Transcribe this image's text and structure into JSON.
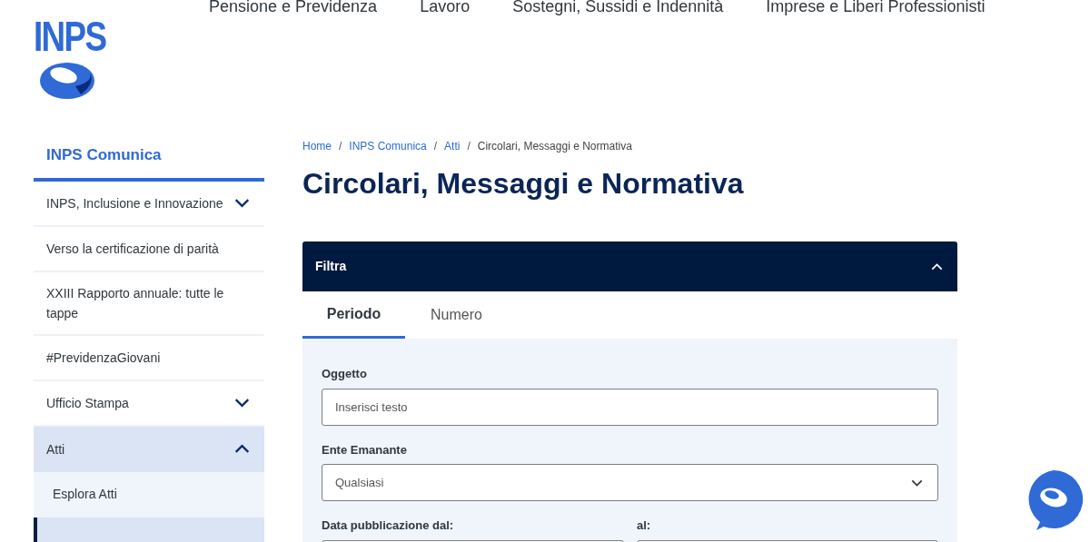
{
  "header": {
    "logo": "INPS",
    "nav": [
      "Pensione e Previdenza",
      "Lavoro",
      "Sostegni, Sussidi e Indennità",
      "Imprese e Liberi Professionisti"
    ]
  },
  "sidebar": {
    "title": "INPS Comunica",
    "items": [
      {
        "label": "INPS, Inclusione e Innovazione",
        "expanded": false
      },
      {
        "label": "Verso la certificazione di parità"
      },
      {
        "label": "XXIII Rapporto annuale: tutte le tappe"
      },
      {
        "label": "#PrevidenzaGiovani"
      },
      {
        "label": "Ufficio Stampa",
        "expanded": false
      },
      {
        "label": "Atti",
        "expanded": true,
        "children": [
          {
            "label": "Esplora Atti",
            "selected": false
          },
          {
            "selected": true
          }
        ]
      }
    ]
  },
  "breadcrumb": [
    {
      "label": "Home",
      "current": false
    },
    {
      "separator": "/",
      "label": "INPS Comunica",
      "current": false
    },
    {
      "separator": "/",
      "label": "Atti",
      "current": false
    },
    {
      "separator": "/",
      "label": "Circolari, Messaggi e Normativa",
      "current": true
    }
  ],
  "title": "Circolari, Messaggi e Normativa",
  "filter": {
    "title": "Filtra",
    "expanded": true,
    "tabs": [
      {
        "label": "Periodo",
        "selected": true
      },
      {
        "label": "Numero",
        "selected": false
      }
    ],
    "fields": [
      {
        "label": "Oggetto",
        "kind": "text",
        "placeholder": "Inserisci testo"
      },
      {
        "label": "Ente Emanante",
        "kind": "select",
        "value": "Qualsiasi"
      }
    ],
    "date_from": {
      "label": "Data pubblicazione dal:"
    },
    "date_to": {
      "label": "al:"
    }
  }
}
